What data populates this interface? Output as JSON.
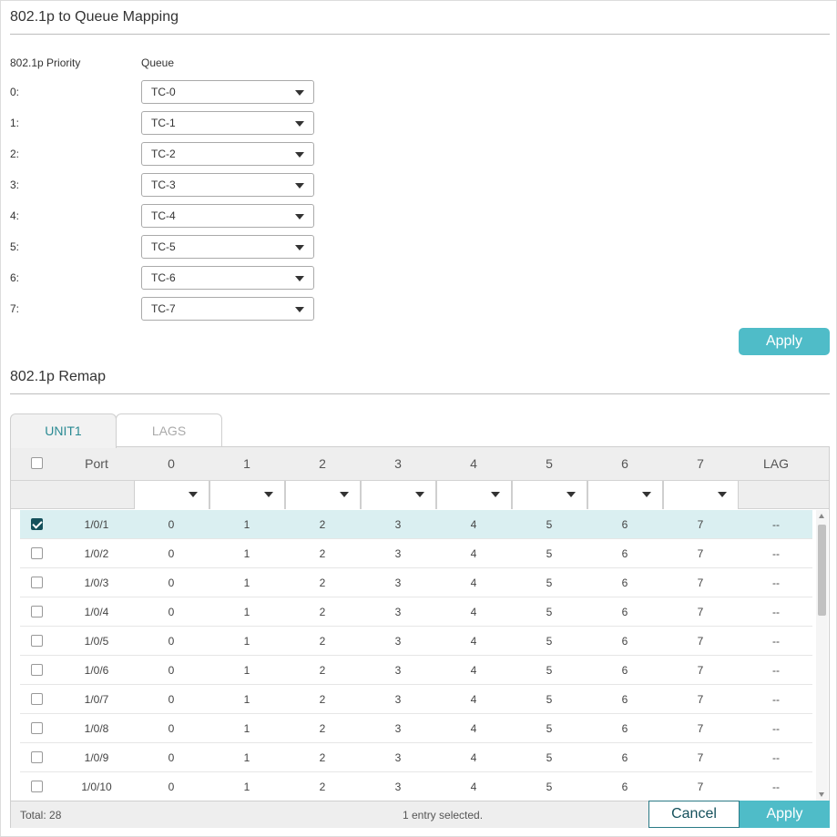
{
  "mapping": {
    "title": "802.1p to Queue Mapping",
    "col_priority": "802.1p Priority",
    "col_queue": "Queue",
    "rows": [
      {
        "label": "0:",
        "queue": "TC-0"
      },
      {
        "label": "1:",
        "queue": "TC-1"
      },
      {
        "label": "2:",
        "queue": "TC-2"
      },
      {
        "label": "3:",
        "queue": "TC-3"
      },
      {
        "label": "4:",
        "queue": "TC-4"
      },
      {
        "label": "5:",
        "queue": "TC-5"
      },
      {
        "label": "6:",
        "queue": "TC-6"
      },
      {
        "label": "7:",
        "queue": "TC-7"
      }
    ],
    "apply_label": "Apply"
  },
  "remap": {
    "title": "802.1p Remap",
    "tabs": [
      {
        "label": "UNIT1",
        "active": true
      },
      {
        "label": "LAGS",
        "active": false
      }
    ],
    "headers": [
      "Port",
      "0",
      "1",
      "2",
      "3",
      "4",
      "5",
      "6",
      "7",
      "LAG"
    ],
    "rows": [
      {
        "port": "1/0/1",
        "v": [
          "0",
          "1",
          "2",
          "3",
          "4",
          "5",
          "6",
          "7"
        ],
        "lag": "--",
        "checked": true
      },
      {
        "port": "1/0/2",
        "v": [
          "0",
          "1",
          "2",
          "3",
          "4",
          "5",
          "6",
          "7"
        ],
        "lag": "--",
        "checked": false
      },
      {
        "port": "1/0/3",
        "v": [
          "0",
          "1",
          "2",
          "3",
          "4",
          "5",
          "6",
          "7"
        ],
        "lag": "--",
        "checked": false
      },
      {
        "port": "1/0/4",
        "v": [
          "0",
          "1",
          "2",
          "3",
          "4",
          "5",
          "6",
          "7"
        ],
        "lag": "--",
        "checked": false
      },
      {
        "port": "1/0/5",
        "v": [
          "0",
          "1",
          "2",
          "3",
          "4",
          "5",
          "6",
          "7"
        ],
        "lag": "--",
        "checked": false
      },
      {
        "port": "1/0/6",
        "v": [
          "0",
          "1",
          "2",
          "3",
          "4",
          "5",
          "6",
          "7"
        ],
        "lag": "--",
        "checked": false
      },
      {
        "port": "1/0/7",
        "v": [
          "0",
          "1",
          "2",
          "3",
          "4",
          "5",
          "6",
          "7"
        ],
        "lag": "--",
        "checked": false
      },
      {
        "port": "1/0/8",
        "v": [
          "0",
          "1",
          "2",
          "3",
          "4",
          "5",
          "6",
          "7"
        ],
        "lag": "--",
        "checked": false
      },
      {
        "port": "1/0/9",
        "v": [
          "0",
          "1",
          "2",
          "3",
          "4",
          "5",
          "6",
          "7"
        ],
        "lag": "--",
        "checked": false
      },
      {
        "port": "1/0/10",
        "v": [
          "0",
          "1",
          "2",
          "3",
          "4",
          "5",
          "6",
          "7"
        ],
        "lag": "--",
        "checked": false
      }
    ],
    "footer": {
      "total": "Total: 28",
      "selected": "1 entry selected.",
      "cancel_label": "Cancel",
      "apply_label": "Apply"
    }
  },
  "colors": {
    "accent": "#4fbcc8",
    "checkbox_checked": "#14505b",
    "selected_row": "#daeff1"
  }
}
